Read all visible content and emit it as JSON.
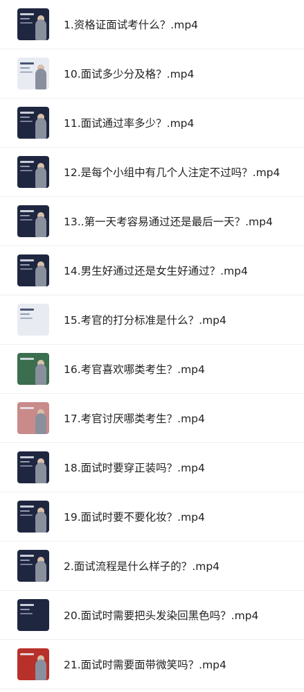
{
  "items": [
    {
      "title": "1.资格证面试考什么？.mp4",
      "thumb": "dark"
    },
    {
      "title": "10.面试多少分及格？.mp4",
      "thumb": "light"
    },
    {
      "title": "11.面试通过率多少？.mp4",
      "thumb": "dark"
    },
    {
      "title": "12.是每个小组中有几个人注定不过吗？.mp4",
      "thumb": "dark"
    },
    {
      "title": "13..第一天考容易通过还是最后一天？.mp4",
      "thumb": "dark"
    },
    {
      "title": "14.男生好通过还是女生好通过？.mp4",
      "thumb": "dark"
    },
    {
      "title": "15.考官的打分标准是什么？.mp4",
      "thumb": "light"
    },
    {
      "title": "16.考官喜欢哪类考生？.mp4",
      "thumb": "green"
    },
    {
      "title": "17.考官讨厌哪类考生？.mp4",
      "thumb": "pink"
    },
    {
      "title": "18.面试时要穿正装吗？.mp4",
      "thumb": "dark"
    },
    {
      "title": "19.面试时要不要化妆？.mp4",
      "thumb": "dark"
    },
    {
      "title": "2.面试流程是什么样子的？.mp4",
      "thumb": "dark"
    },
    {
      "title": "20.面试时需要把头发染回黑色吗？.mp4",
      "thumb": "dark"
    },
    {
      "title": "21.面试时需要面带微笑吗？.mp4",
      "thumb": "red"
    }
  ]
}
